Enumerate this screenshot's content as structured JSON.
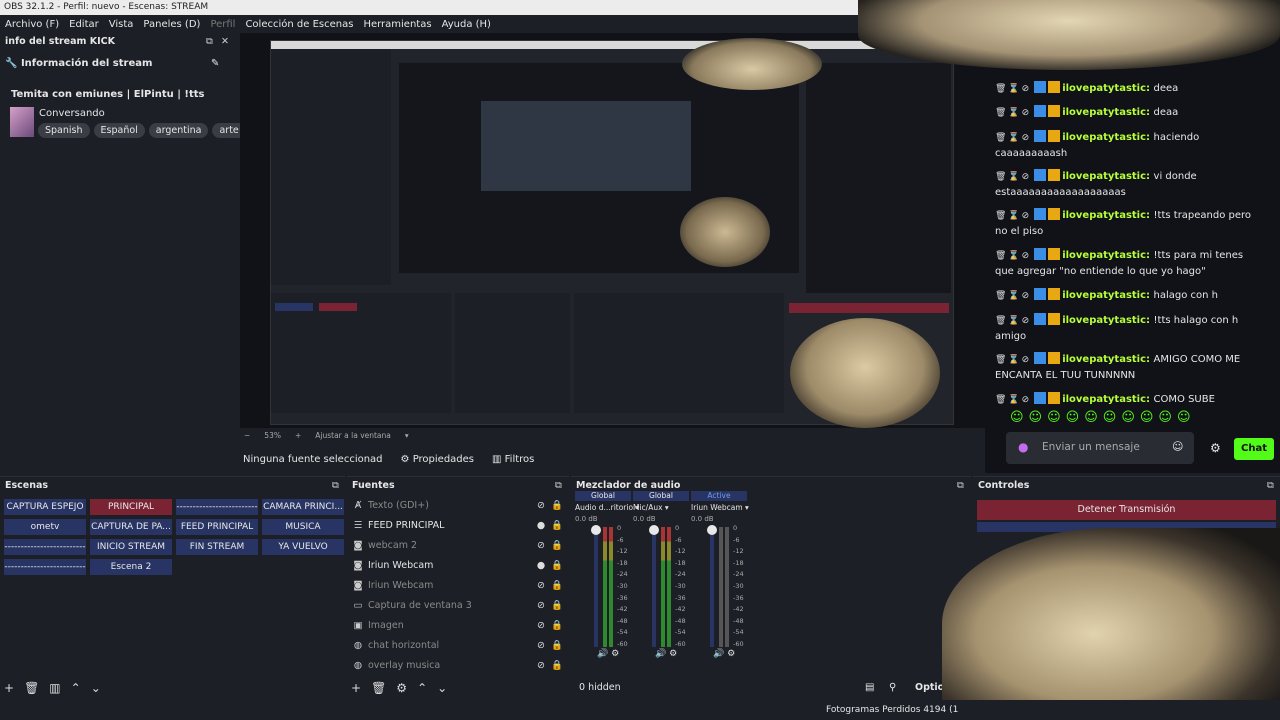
{
  "window": {
    "title": "OBS 32.1.2 - Perfil: nuevo - Escenas: STREAM"
  },
  "menu": [
    "Archivo (F)",
    "Editar",
    "Vista",
    "Paneles (D)",
    "Perfil",
    "Colección de Escenas",
    "Herramientas",
    "Ayuda (H)"
  ],
  "stream_info": {
    "dock_title": "info del stream KICK",
    "section_title": "Información del stream",
    "stream_title": "Temita con emiunes | ElPintu | !tts",
    "category": "Conversando",
    "tags": [
      "Spanish",
      "Español",
      "argentina",
      "arte"
    ]
  },
  "preview": {
    "zoom": "53%",
    "zoom_action": "Ajustar a la ventana",
    "no_source": "Ninguna fuente seleccionad",
    "properties_label": "Propiedades",
    "filters_label": "Filtros"
  },
  "scenes": {
    "title": "Escenas",
    "items": [
      {
        "label": "CAPTURA ESPEJO",
        "active": false
      },
      {
        "label": "PRINCIPAL",
        "active": true
      },
      {
        "label": "-------------------------",
        "active": false
      },
      {
        "label": "CAMARA PRINCI...",
        "active": false
      },
      {
        "label": "ometv",
        "active": false
      },
      {
        "label": "CAPTURA DE PA...",
        "active": false
      },
      {
        "label": "FEED PRINCIPAL",
        "active": false
      },
      {
        "label": "MUSICA",
        "active": false
      },
      {
        "label": "-------------------------",
        "active": false
      },
      {
        "label": "INICIO STREAM",
        "active": false
      },
      {
        "label": "FIN STREAM",
        "active": false
      },
      {
        "label": "YA VUELVO",
        "active": false
      },
      {
        "label": "-------------------------",
        "active": false
      },
      {
        "label": "Escena 2",
        "active": false
      }
    ]
  },
  "sources": {
    "title": "Fuentes",
    "items": [
      {
        "label": "Texto (GDI+)",
        "visible": false,
        "icon": "text-icon"
      },
      {
        "label": "FEED PRINCIPAL",
        "visible": true,
        "icon": "list-icon"
      },
      {
        "label": "webcam 2",
        "visible": false,
        "icon": "camera-icon"
      },
      {
        "label": "Iriun Webcam",
        "visible": true,
        "icon": "camera-icon"
      },
      {
        "label": "Iriun Webcam",
        "visible": false,
        "icon": "camera-icon"
      },
      {
        "label": "Captura de ventana 3",
        "visible": false,
        "icon": "window-icon"
      },
      {
        "label": "Imagen",
        "visible": false,
        "icon": "image-icon"
      },
      {
        "label": "chat horizontal",
        "visible": false,
        "icon": "globe-icon"
      },
      {
        "label": "overlay musica",
        "visible": false,
        "icon": "globe-icon"
      }
    ]
  },
  "mixer": {
    "title": "Mezclador de audio",
    "channels": [
      {
        "tag": "Global",
        "name": "Audio d...ritorio",
        "db": "0.0 dB"
      },
      {
        "tag": "Global",
        "name": "Mic/Aux",
        "db": "0.0 dB"
      },
      {
        "tag": "Active",
        "name": "Iriun Webcam",
        "db": "0.0 dB"
      }
    ],
    "scale": [
      "0",
      "-6",
      "-12",
      "-18",
      "-24",
      "-30",
      "-36",
      "-42",
      "-48",
      "-54",
      "-60"
    ],
    "hidden": "0 hidden",
    "options": "Optior"
  },
  "controls": {
    "title": "Controles",
    "stop_stream": "Detener Transmisión"
  },
  "chat": {
    "title": "Chat",
    "messages": [
      {
        "user": "ilovepatytastic",
        "text": "deea"
      },
      {
        "user": "ilovepatytastic",
        "text": "deaa"
      },
      {
        "user": "ilovepatytastic",
        "text": "haciendo caaaaaaaaash"
      },
      {
        "user": "ilovepatytastic",
        "text": "vi donde estaaaaaaaaaaaaaaaaaas"
      },
      {
        "user": "ilovepatytastic",
        "text": "!tts trapeando pero no el piso"
      },
      {
        "user": "ilovepatytastic",
        "text": "!tts para mi tenes que agregar \"no entiende lo que yo hago\""
      },
      {
        "user": "ilovepatytastic",
        "text": "halago con h"
      },
      {
        "user": "ilovepatytastic",
        "text": "!tts halago con h amigo"
      },
      {
        "user": "ilovepatytastic",
        "text": "AMIGO COMO ME ENCANTA EL TUU TUNNNNN"
      },
      {
        "user": "ilovepatytastic",
        "text": "COMO SUBE"
      }
    ],
    "input_placeholder": "Enviar un mensaje",
    "send_label": "Chat"
  },
  "status": {
    "dropped_frames": "Fotogramas Perdidos 4194 (1"
  },
  "colors": {
    "accent_green": "#53fc18",
    "scene_blue": "#283463",
    "scene_active": "#7a2433",
    "username": "#b8ff3a"
  }
}
